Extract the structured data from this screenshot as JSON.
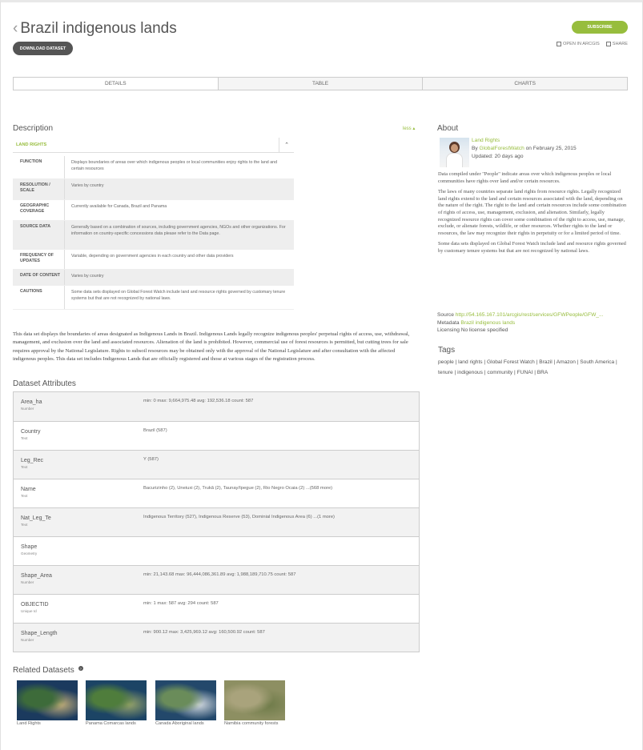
{
  "header": {
    "back_glyph": "‹",
    "title": "Brazil indigenous lands",
    "download_label": "DOWNLOAD DATASET",
    "subscribe_label": "SUBSCRIBE",
    "open_arcgis_label": "OPEN IN ARCGIS",
    "share_label": "SHARE"
  },
  "tabs": [
    {
      "label": "DETAILS"
    },
    {
      "label": "TABLE"
    },
    {
      "label": "CHARTS"
    }
  ],
  "description": {
    "heading": "Description",
    "less_label": "less ▴",
    "section_title": "LAND RIGHTS",
    "caret": "⌃",
    "rows": [
      {
        "key": "FUNCTION",
        "value": "Displays boundaries of areas over which indigenous peoples or local communities enjoy rights to the land and certain resources"
      },
      {
        "key": "RESOLUTION / SCALE",
        "value": "Varies by country"
      },
      {
        "key": "GEOGRAPHIC COVERAGE",
        "value": "Currently available for Canada, Brazil and Panama"
      },
      {
        "key": "SOURCE DATA",
        "value": "Generally based on a combination of sources, including government agencies, NGOs and other organizations. For information on country-specific concessions data please refer to the Data page."
      },
      {
        "key": "FREQUENCY OF UPDATES",
        "value": "Variable, depending on government agencies in each country and other data providers"
      },
      {
        "key": "DATE OF CONTENT",
        "value": "Varies by country"
      },
      {
        "key": "CAUTIONS",
        "value": "Some data sets displayed on Global Forest Watch include land and resource rights governed by customary tenure systems but that are not recognized by national laws."
      }
    ],
    "paragraph": "This data set displays the boundaries of areas designated as Indigenous Lands in Brazil. Indigenous Lands legally recognize indigenous peoples' perpetual rights of access, use, withdrawal, management, and exclusion over the land and associated resources. Alienation of the land is prohibited. However, commercial use of forest resources is permitted, but cutting trees for sale requires approval by the National Legislature. Rights to subsoil resources may be obtained only with the approval of the National Legislature and after consultation with the affected indigenous peoples. This data set includes Indigenous Lands that are officially registered and those at various stages of the registration process."
  },
  "attributes": {
    "heading": "Dataset Attributes",
    "rows": [
      {
        "name": "Area_ha",
        "type": "Number",
        "stats": "min: 0   max: 9,664,975.48   avg: 192,536.18   count: 587"
      },
      {
        "name": "Country",
        "type": "Text",
        "stats": "Brazil (587)"
      },
      {
        "name": "Leg_Rec",
        "type": "Text",
        "stats": "Y (587)"
      },
      {
        "name": "Name",
        "type": "Text",
        "stats": "Bacurizinho (2), Uneiuxi (2), Trukã (2), Taunay/Ipegue (2), Rio Negro Ocaia (2) ...(568 more)"
      },
      {
        "name": "Nat_Leg_Te",
        "type": "Text",
        "stats": "Indigenous Territory (527), Indigenous Reserve (53), Dominial Indigenous Area (6) ...(1 more)"
      },
      {
        "name": "Shape",
        "type": "Geometry",
        "stats": ""
      },
      {
        "name": "Shape_Area",
        "type": "Number",
        "stats": "min: 21,143.68   max: 96,444,086,361.89   avg: 1,988,189,710.75   count: 587"
      },
      {
        "name": "OBJECTID",
        "type": "Unique Id",
        "stats": "min: 1   max: 587   avg: 294   count: 587"
      },
      {
        "name": "Shape_Length",
        "type": "Number",
        "stats": "min: 900.12   max: 3,425,969.12   avg: 160,500.92   count: 587"
      }
    ]
  },
  "related": {
    "heading": "Related Datasets",
    "items": [
      {
        "caption": "Land Rights",
        "colors": [
          "#1b3a5e",
          "#3d6b3a",
          "#c8b27a"
        ]
      },
      {
        "caption": "Panama Comarcas lands",
        "colors": [
          "#1c4465",
          "#4f7d3c",
          "#9aa66a"
        ]
      },
      {
        "caption": "Canada Aboriginal lands",
        "colors": [
          "#23486b",
          "#6a8c5a",
          "#d7dde2"
        ]
      },
      {
        "caption": "Namibia community forests",
        "colors": [
          "#8d8f62",
          "#a9a37c",
          "#6d7a48"
        ]
      }
    ]
  },
  "about": {
    "heading": "About",
    "category": "Land Rights",
    "by_label": "By",
    "author": "GlobalForestWatch",
    "date_text": "on February 25, 2015",
    "updated": "Updated: 20 days ago",
    "paragraphs": [
      "Data compiled under \"People\" indicate areas over which indigenous peoples or local communities have rights over land and/or certain resources.",
      "The laws of many countries separate land rights from resource rights. Legally recognized land rights extend to the land and certain resources associated with the land, depending on the nature of the right. The right to the land and certain resources include some combination of rights of access, use, management, exclusion, and alienation. Similarly, legally recognized resource rights can cover some combination of the right to access, use, manage, exclude, or alienate forests, wildlife, or other resources. Whether rights to the land or resources, the law may recognize their rights in perpetuity or for a limited period of time.",
      "Some data sets displayed on Global Forest Watch include land and resource rights governed by customary tenure systems but that are not recognized by national laws."
    ],
    "source_label": "Source",
    "source_url": "http://54.165.167.101/arcgis/rest/services/GFWPeople/GFW_...",
    "metadata_label": "Metadata",
    "metadata_link": "Brazil indigenous lands",
    "licensing": "Licensing No license specified"
  },
  "tags": {
    "heading": "Tags",
    "text": "people | land rights | Global Forest Watch | Brazil | Amazon | South America | tenure | indigenous | community | FUNAI | BRA"
  },
  "colors": {
    "accent_green": "#97bd3d",
    "dark_button": "#555555"
  }
}
